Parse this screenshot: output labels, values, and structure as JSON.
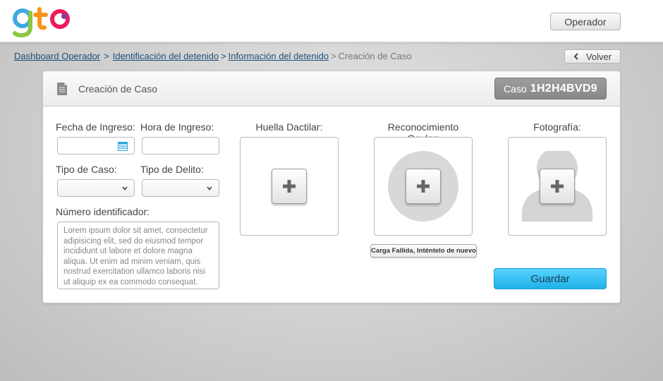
{
  "header": {
    "logo_text": "gto",
    "operator_button": "Operador"
  },
  "breadcrumb": {
    "items": [
      "Dashboard Operador",
      "Identificación del detenido",
      "Información del detenido"
    ],
    "separator": ">",
    "current": "Creación de Caso"
  },
  "back_button": "Volver",
  "panel": {
    "title": "Creación de Caso",
    "case_prefix": "Caso",
    "case_id": "1H2H4BVD9"
  },
  "form": {
    "fecha_label": "Fecha de Ingreso:",
    "fecha_value": "",
    "hora_label": "Hora de Ingreso:",
    "hora_value": "",
    "tipo_caso_label": "Tipo de Caso:",
    "tipo_caso_value": "",
    "tipo_delito_label": "Tipo de Delito:",
    "tipo_delito_value": "",
    "numero_label": "Número identificador:",
    "numero_value": "Lorem ipsum dolor sit amet, consectetur adipisicing elit, sed do eiusmod tempor incididunt ut labore et dolore magna aliqua. Ut enim ad minim veniam, quis nostrud exercitation ullamco laboris nisi ut aliquip ex ea commodo consequat."
  },
  "biometrics": {
    "huella_label": "Huella Dactilar:",
    "ocular_label": "Reconocimiento Ocular:",
    "foto_label": "Fotografía:",
    "ocular_error": "Carga Fallida, Inténtelo de nuevo"
  },
  "save_button": "Guardar",
  "colors": {
    "accent": "#2dbdf2",
    "link": "#1f4f7a",
    "badge": "#939393"
  },
  "icons": [
    "gto-logo",
    "document-icon",
    "calendar-icon",
    "chevron-down-icon",
    "chevron-left-icon",
    "plus-icon",
    "person-silhouette-icon"
  ]
}
